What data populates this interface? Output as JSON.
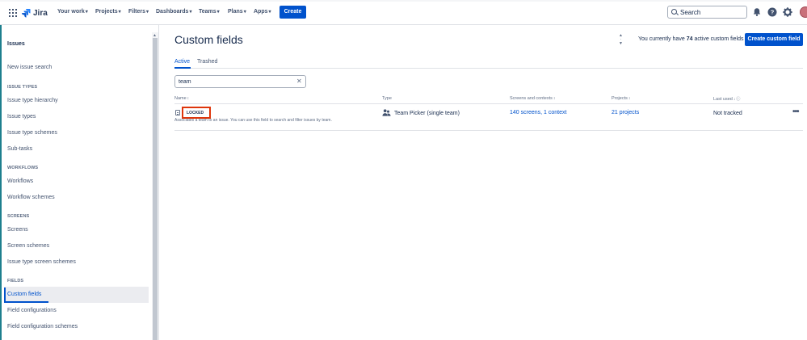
{
  "app": {
    "logo_text": "Jira"
  },
  "nav": {
    "items": [
      {
        "label": "Your work"
      },
      {
        "label": "Projects"
      },
      {
        "label": "Filters"
      },
      {
        "label": "Dashboards"
      },
      {
        "label": "Teams"
      },
      {
        "label": "Plans"
      },
      {
        "label": "Apps"
      }
    ],
    "create_label": "Create",
    "search_placeholder": "Search"
  },
  "sidebar": {
    "heading": "Issues",
    "new_issue_search": "New issue search",
    "sections": [
      {
        "title": "ISSUE TYPES",
        "items": [
          "Issue type hierarchy",
          "Issue types",
          "Issue type schemes",
          "Sub-tasks"
        ]
      },
      {
        "title": "WORKFLOWS",
        "items": [
          "Workflows",
          "Workflow schemes"
        ]
      },
      {
        "title": "SCREENS",
        "items": [
          "Screens",
          "Screen schemes",
          "Issue type screen schemes"
        ]
      },
      {
        "title": "FIELDS",
        "items": [
          "Custom fields",
          "Field configurations",
          "Field configuration schemes"
        ]
      }
    ]
  },
  "main": {
    "title": "Custom fields",
    "active_count_prefix": "You currently have",
    "active_count": "74",
    "active_count_suffix": "active custom fields",
    "create_button": "Create custom field",
    "tabs": [
      {
        "label": "Active"
      },
      {
        "label": "Trashed"
      }
    ],
    "filter_value": "team",
    "columns": [
      "Name",
      "Type",
      "Screens and contexts",
      "Projects",
      "Last used"
    ],
    "row": {
      "badge": "LOCKED",
      "description": "Associates a team to an issue. You can use this field to search and filter issues by team.",
      "type": "Team Picker (single team)",
      "screens": "140 screens, 1 context",
      "projects": "21 projects",
      "last_used": "Not tracked"
    }
  },
  "colors": {
    "accent": "#0052cc",
    "locked_highlight": "#de350b"
  }
}
